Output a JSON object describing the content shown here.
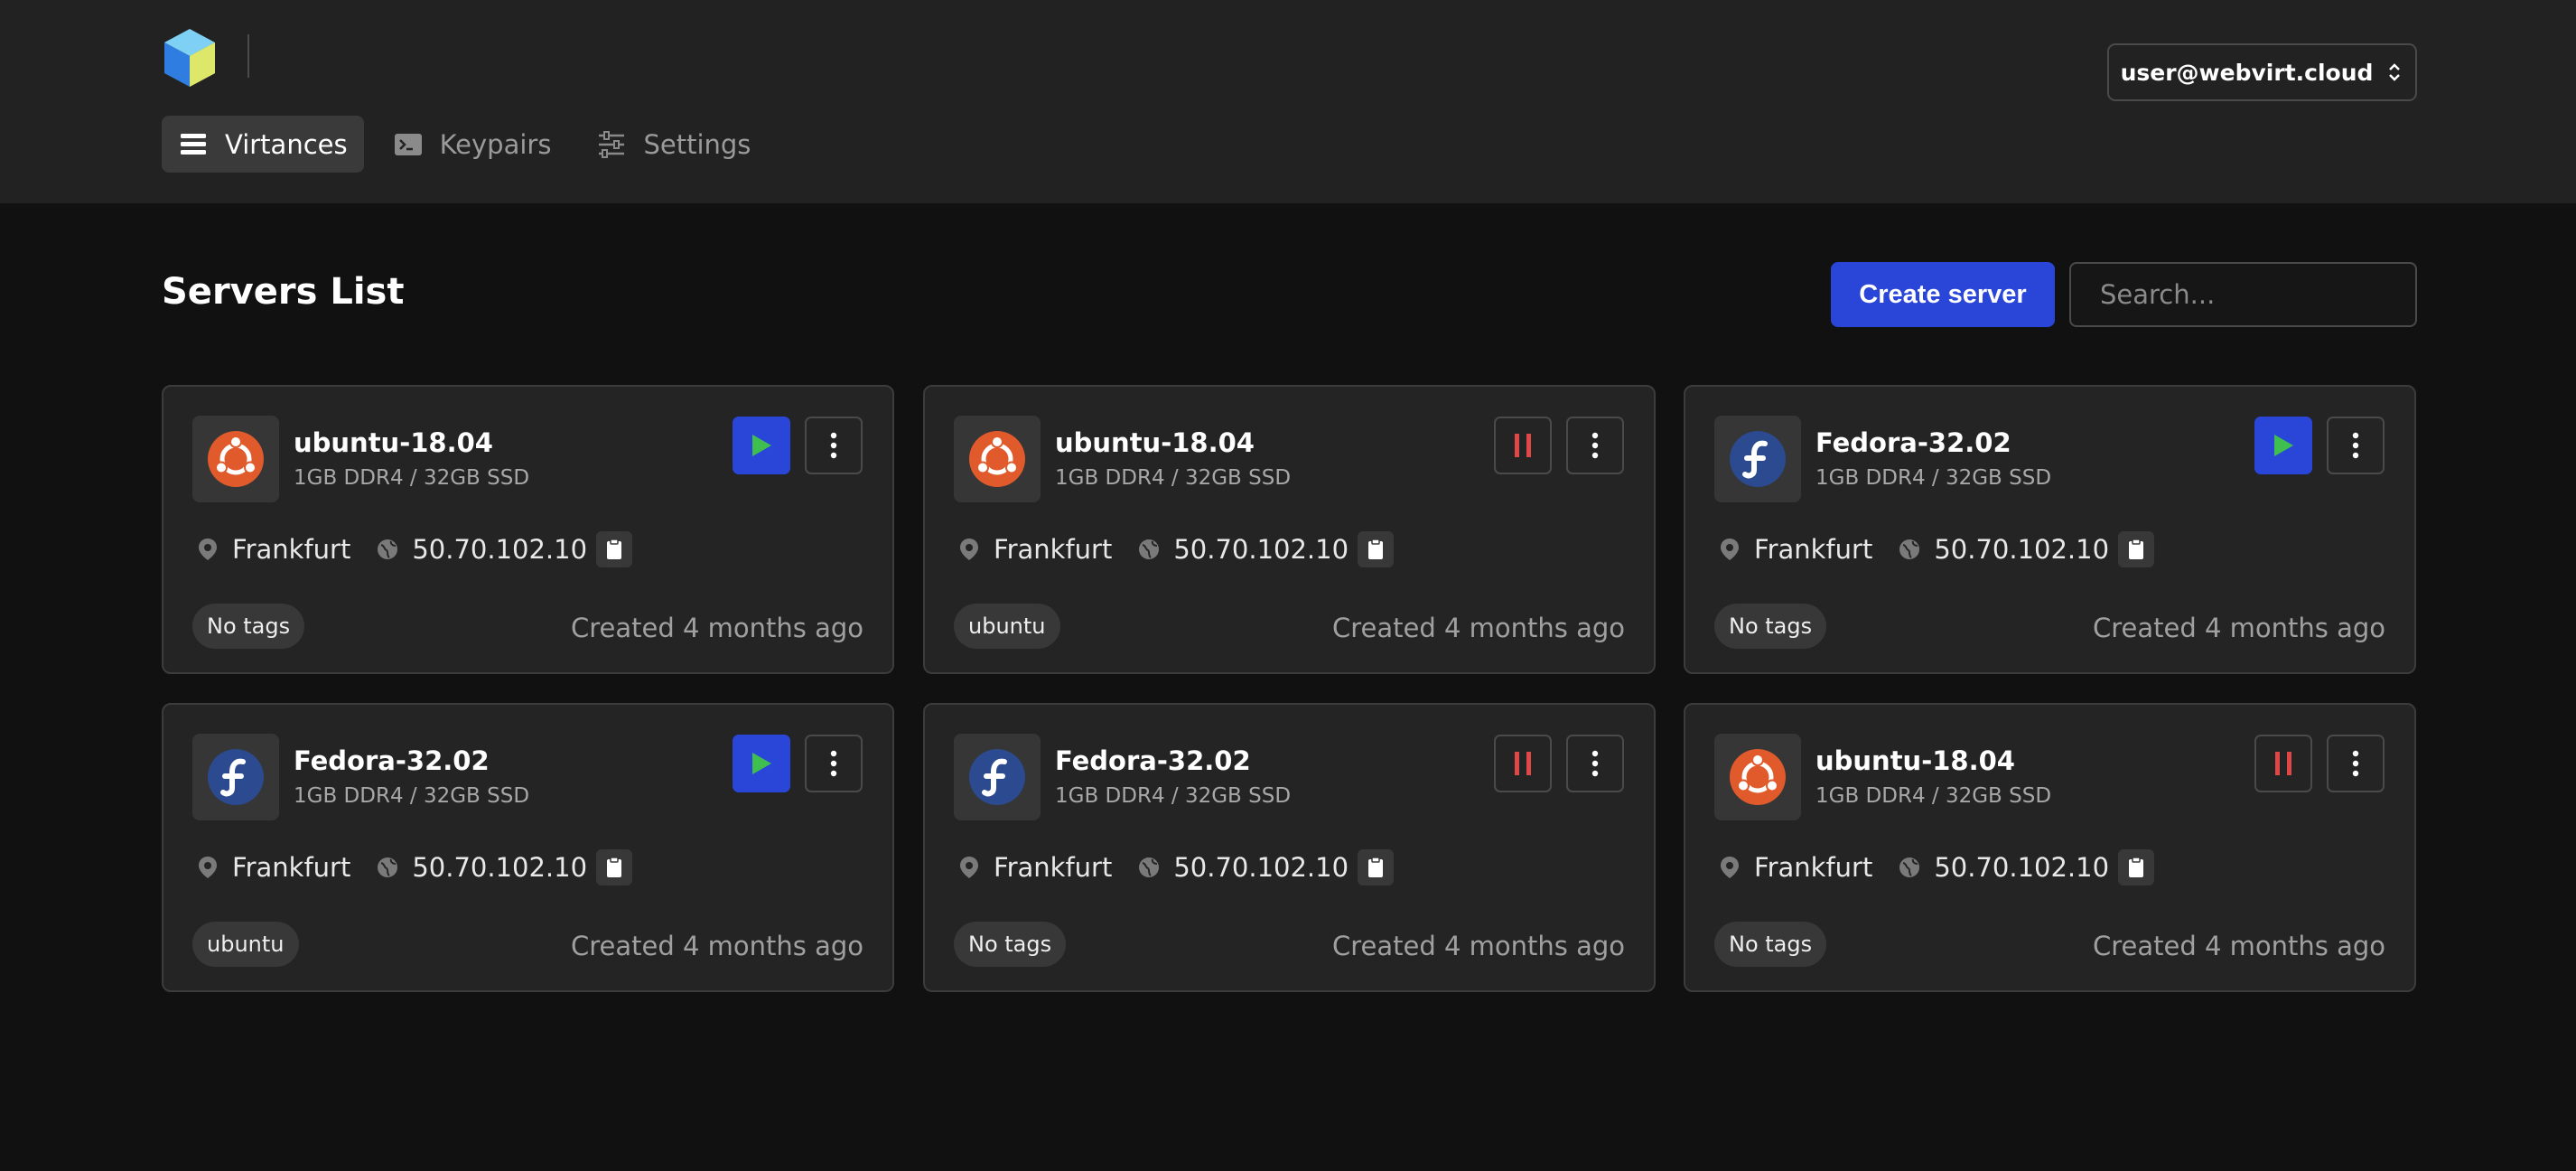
{
  "app": {
    "brand_icon": "cube-logo-icon"
  },
  "nav": {
    "items": [
      {
        "label": "Virtances",
        "icon": "list-icon",
        "active": true
      },
      {
        "label": "Keypairs",
        "icon": "terminal-icon",
        "active": false
      },
      {
        "label": "Settings",
        "icon": "sliders-icon",
        "active": false
      }
    ]
  },
  "user_menu": {
    "label": "user@webvirt.cloud",
    "icon": "chevron-updown-icon"
  },
  "page": {
    "title": "Servers List"
  },
  "toolbar": {
    "create_label": "Create server",
    "search_placeholder": "Search..."
  },
  "colors": {
    "accent": "#2a46d9",
    "play_icon": "#3fbf4f",
    "pause_icon": "#e04848",
    "ubuntu": "#e05a2b",
    "fedora": "#2b4a8f"
  },
  "servers": [
    {
      "name": "ubuntu-18.04",
      "os": "ubuntu",
      "spec": "1GB DDR4 / 32GB SSD",
      "location": "Frankfurt",
      "ip": "50.70.102.10",
      "state": "stopped",
      "tag": "No tags",
      "created": "Created 4 months ago"
    },
    {
      "name": "ubuntu-18.04",
      "os": "ubuntu",
      "spec": "1GB DDR4 / 32GB SSD",
      "location": "Frankfurt",
      "ip": "50.70.102.10",
      "state": "running",
      "tag": "ubuntu",
      "created": "Created 4 months ago"
    },
    {
      "name": "Fedora-32.02",
      "os": "fedora",
      "spec": "1GB DDR4 / 32GB SSD",
      "location": "Frankfurt",
      "ip": "50.70.102.10",
      "state": "stopped",
      "tag": "No tags",
      "created": "Created 4 months ago"
    },
    {
      "name": "Fedora-32.02",
      "os": "fedora",
      "spec": "1GB DDR4 / 32GB SSD",
      "location": "Frankfurt",
      "ip": "50.70.102.10",
      "state": "stopped",
      "tag": "ubuntu",
      "created": "Created 4 months ago"
    },
    {
      "name": "Fedora-32.02",
      "os": "fedora",
      "spec": "1GB DDR4 / 32GB SSD",
      "location": "Frankfurt",
      "ip": "50.70.102.10",
      "state": "running",
      "tag": "No tags",
      "created": "Created 4 months ago"
    },
    {
      "name": "ubuntu-18.04",
      "os": "ubuntu",
      "spec": "1GB DDR4 / 32GB SSD",
      "location": "Frankfurt",
      "ip": "50.70.102.10",
      "state": "running",
      "tag": "No tags",
      "created": "Created 4 months ago"
    }
  ]
}
